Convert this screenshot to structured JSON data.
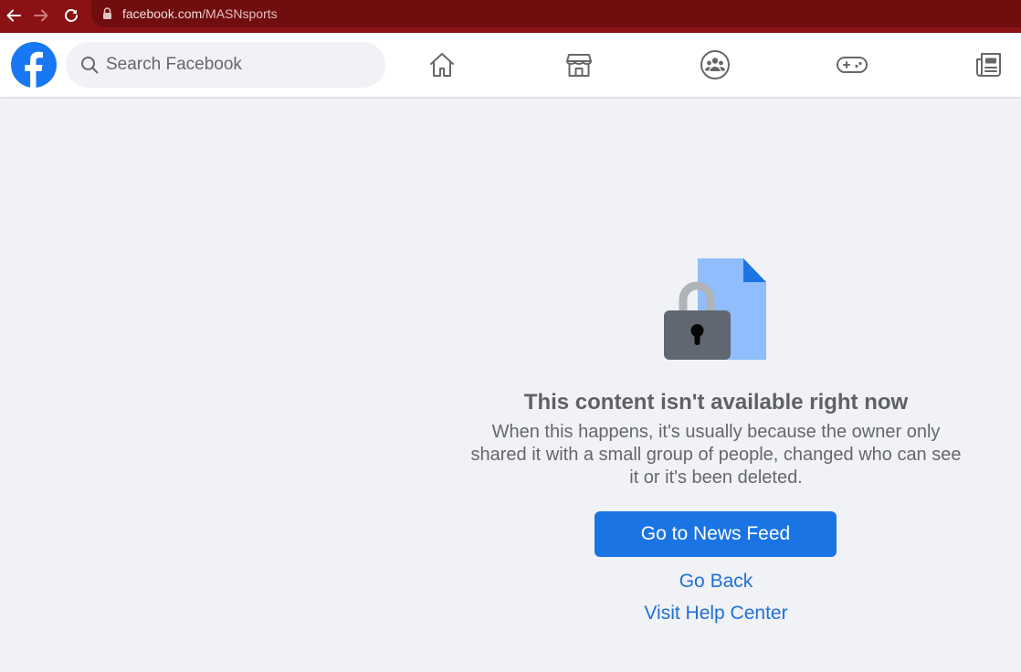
{
  "browser": {
    "url_domain": "facebook.com",
    "url_path": "/MASNsports"
  },
  "header": {
    "search": {
      "placeholder": "Search Facebook"
    },
    "tabs": [
      "home",
      "marketplace",
      "groups",
      "gaming",
      "news"
    ]
  },
  "content": {
    "title": "This content isn't available right now",
    "description": "When this happens, it's usually because the owner only shared it with a small group of people, changed who can see it or it's been deleted.",
    "primary_button": "Go to News Feed",
    "link_back": "Go Back",
    "link_help": "Visit Help Center"
  },
  "colors": {
    "browser_bar": "#8b1214",
    "brand_blue": "#1877f2",
    "button_blue": "#1b74e4",
    "link_blue": "#216fdb"
  },
  "icons": {
    "back": "arrow-left-icon",
    "forward": "arrow-right-icon",
    "reload": "reload-icon",
    "lock": "lock-icon",
    "logo": "facebook-logo-icon",
    "search": "search-icon",
    "home": "home-icon",
    "marketplace": "store-icon",
    "groups": "groups-icon",
    "gaming": "gamepad-icon",
    "news": "newspaper-icon",
    "illustration": "locked-document-icon"
  }
}
